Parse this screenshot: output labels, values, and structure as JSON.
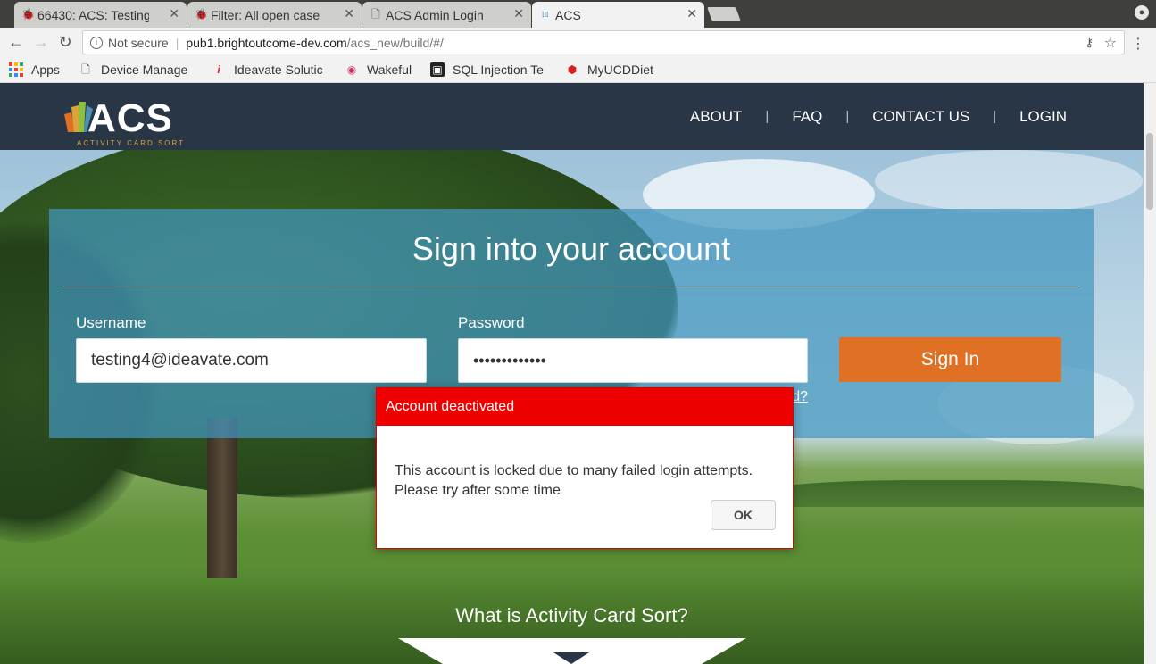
{
  "browser": {
    "tabs": [
      {
        "title": "66430: ACS: Testing",
        "favicon": "bug-icon"
      },
      {
        "title": "Filter: All open case",
        "favicon": "bug-icon"
      },
      {
        "title": "ACS Admin Login",
        "favicon": "page-icon"
      },
      {
        "title": "ACS",
        "favicon": "acs-icon",
        "active": true
      }
    ],
    "address": {
      "security_label": "Not secure",
      "host": "pub1.brightoutcome-dev.com",
      "path": "/acs_new/build/#/"
    },
    "bookmarks": [
      {
        "label": "Apps",
        "icon": "apps-icon"
      },
      {
        "label": "Device Manage",
        "icon": "page-icon"
      },
      {
        "label": "Ideavate Solutic",
        "icon": "info-i-icon"
      },
      {
        "label": "Wakeful",
        "icon": "circle-icon"
      },
      {
        "label": "SQL Injection Te",
        "icon": "cube-icon"
      },
      {
        "label": "MyUCDDiet",
        "icon": "angular-icon"
      }
    ]
  },
  "site": {
    "logo_text": "ACS",
    "logo_tagline": "ACTIVITY CARD SORT",
    "nav": [
      {
        "label": "ABOUT"
      },
      {
        "label": "FAQ"
      },
      {
        "label": "CONTACT US"
      },
      {
        "label": "LOGIN",
        "active": true
      }
    ]
  },
  "signin": {
    "title": "Sign into your account",
    "username_label": "Username",
    "username_value": "testing4@ideavate.com",
    "password_label": "Password",
    "password_value": "•••••••••••••",
    "button_label": "Sign In",
    "forgot_label": "d?"
  },
  "section_heading": "What is Activity Card Sort?",
  "modal": {
    "title": "Account deactivated",
    "message": "This account is locked due to many failed login attempts. Please try after some time",
    "ok_label": "OK"
  },
  "colors": {
    "header_bg": "#283645",
    "panel_bg": "#4296be",
    "signin_button": "#e07124",
    "modal_header": "#ee0000"
  }
}
